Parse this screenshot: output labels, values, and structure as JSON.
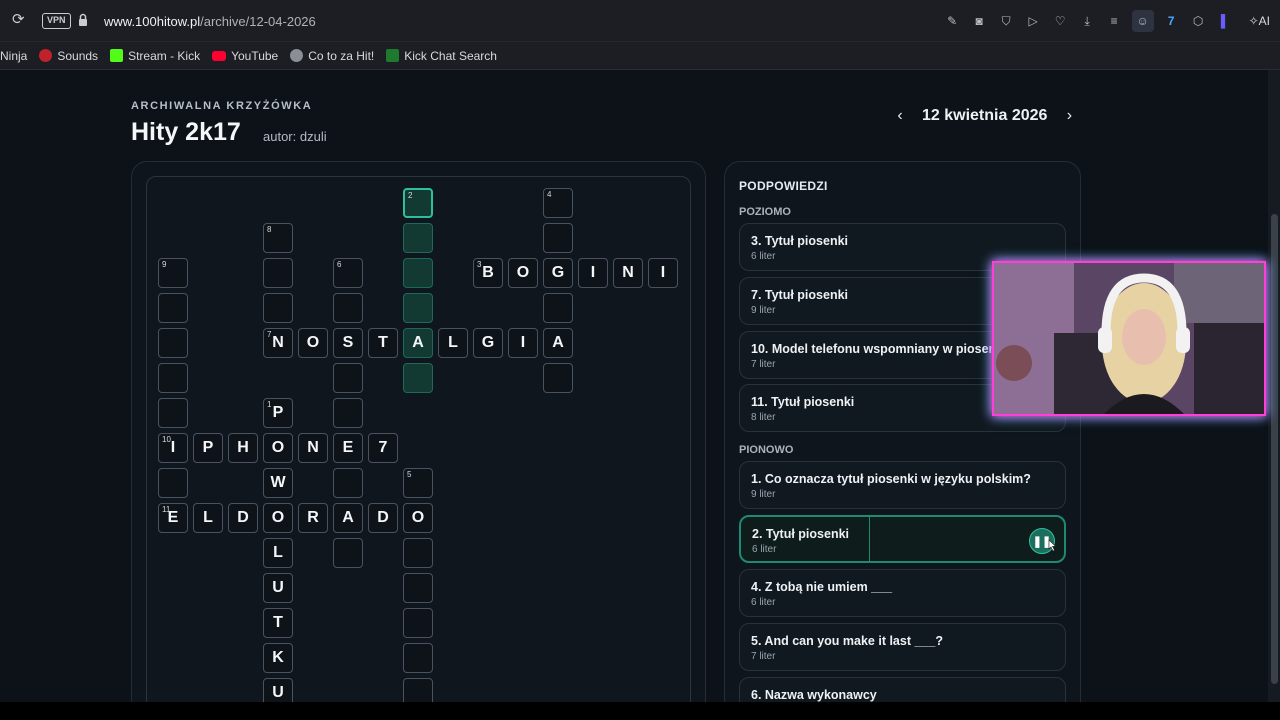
{
  "browser": {
    "vpn_label": "VPN",
    "url_domain": "www.100hitow.pl",
    "url_path": "/archive/12-04-2026",
    "ai_label": "AI",
    "bookmarks": [
      "Ninja",
      "Sounds",
      "Stream - Kick",
      "YouTube",
      "Co to za Hit!",
      "Kick Chat Search"
    ]
  },
  "header": {
    "eyebrow": "ARCHIWALNA KRZYŻÓWKA",
    "title": "Hity 2k17",
    "author": "autor: dzuli",
    "date": "12 kwietnia 2026",
    "prev_icon": "chevron-left-icon",
    "next_icon": "chevron-right-icon"
  },
  "grid": {
    "numbers": {
      "n1": "1",
      "n2": "2",
      "n3": "3",
      "n4": "4",
      "n5": "5",
      "n6": "6",
      "n7": "7",
      "n8": "8",
      "n9": "9",
      "n10": "10",
      "n11": "11"
    },
    "bogini": [
      "B",
      "O",
      "G",
      "I",
      "N",
      "I"
    ],
    "nostalgia": [
      "N",
      "O",
      "S",
      "T",
      "A",
      "L",
      "G",
      "I",
      "A"
    ],
    "iphone7": [
      "I",
      "P",
      "H",
      "O",
      "N",
      "E",
      "7"
    ],
    "eldorado": [
      "E",
      "L",
      "D",
      "O",
      "R",
      "A",
      "D",
      "O"
    ],
    "col1_extra": [
      "P",
      "W",
      "L",
      "U",
      "T",
      "K",
      "U"
    ]
  },
  "clues": {
    "title": "PODPOWIEDZI",
    "across_label": "POZIOMO",
    "down_label": "PIONOWO",
    "across": [
      {
        "text": "3. Tytuł piosenki",
        "sub": "6 liter"
      },
      {
        "text": "7. Tytuł piosenki",
        "sub": "9 liter"
      },
      {
        "text": "10. Model telefonu wspomniany w piosence",
        "sub": "7 liter"
      },
      {
        "text": "11. Tytuł piosenki",
        "sub": "8 liter"
      }
    ],
    "down": [
      {
        "text": "1. Co oznacza tytuł piosenki w języku polskim?",
        "sub": "9 liter"
      },
      {
        "text": "2. Tytuł piosenki",
        "sub": "6 liter"
      },
      {
        "text": "4. Z tobą nie umiem ___",
        "sub": "6 liter"
      },
      {
        "text": "5. And can you make it last ___?",
        "sub": "7 liter"
      },
      {
        "text": "6. Nazwa wykonawcy",
        "sub": ""
      }
    ],
    "active_clue": "2. Tytuł piosenki",
    "pause_icon": "pause-icon"
  },
  "colors": {
    "accent": "#2fbf9c",
    "background": "#0c1218",
    "webcam_border_pink": "#ff3fd8",
    "webcam_border_cyan": "#24e7ff"
  }
}
